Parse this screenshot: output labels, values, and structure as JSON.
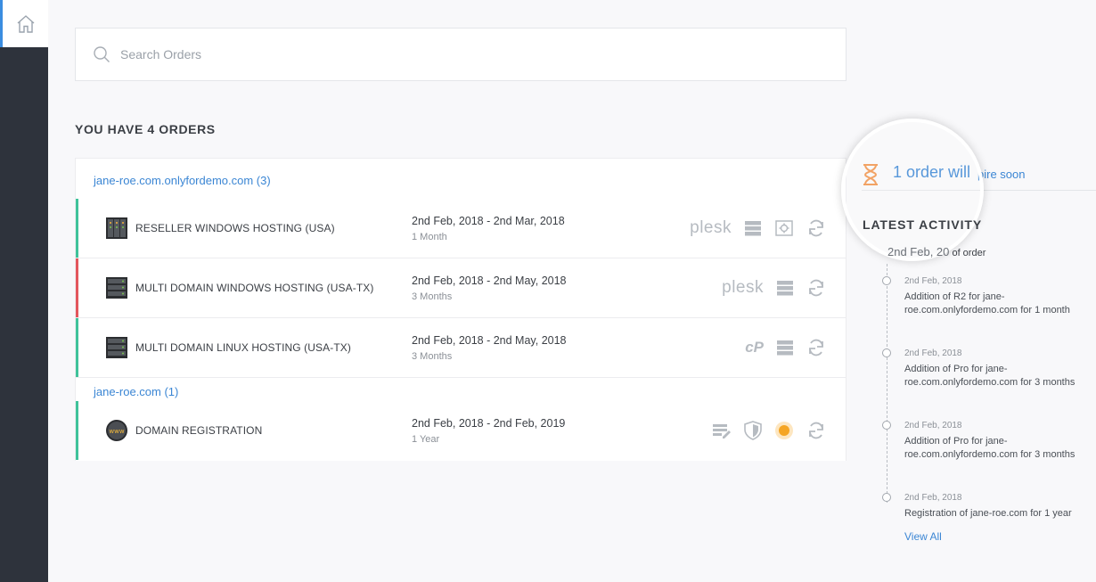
{
  "search": {
    "placeholder": "Search Orders"
  },
  "heading": "YOU HAVE 4 ORDERS",
  "colors": {
    "accent": "#3b86d4",
    "green": "#3fc29a",
    "red": "#e3565c",
    "orange": "#f5a524",
    "sidebar": "#2e333c"
  },
  "groups": [
    {
      "title": "jane-roe.com.onlyfordemo.com (3)",
      "orders": [
        {
          "name": "RESELLER WINDOWS HOSTING (USA)",
          "dates": "2nd Feb, 2018 - 2nd Mar, 2018",
          "duration": "1 Month",
          "status": "green",
          "panel": "plesk"
        },
        {
          "name": "MULTI DOMAIN WINDOWS HOSTING (USA-TX)",
          "dates": "2nd Feb, 2018 - 2nd May, 2018",
          "duration": "3 Months",
          "status": "red",
          "panel": "plesk"
        },
        {
          "name": "MULTI DOMAIN LINUX HOSTING (USA-TX)",
          "dates": "2nd Feb, 2018 - 2nd May, 2018",
          "duration": "3 Months",
          "status": "green",
          "panel": "cP"
        }
      ]
    },
    {
      "title": "jane-roe.com (1)",
      "orders": [
        {
          "name": "DOMAIN REGISTRATION",
          "dates": "2nd Feb, 2018 - 2nd Feb, 2019",
          "duration": "1 Year",
          "status": "green"
        }
      ]
    }
  ],
  "expire": {
    "big": "1 order will",
    "small": "pire soon"
  },
  "activity": {
    "title": "LATEST ACTIVITY",
    "first_mag": "2nd Feb, 20",
    "first_rest": "of order",
    "items": [
      {
        "date": "2nd Feb, 2018",
        "text": "Addition of R2 for jane-roe.com.onlyfordemo.com for 1 month"
      },
      {
        "date": "2nd Feb, 2018",
        "text": "Addition of Pro for jane-roe.com.onlyfordemo.com for 3 months"
      },
      {
        "date": "2nd Feb, 2018",
        "text": "Addition of Pro for jane-roe.com.onlyfordemo.com for 3 months"
      },
      {
        "date": "2nd Feb, 2018",
        "text": "Registration of jane-roe.com for 1 year"
      }
    ],
    "view_all": "View All"
  }
}
